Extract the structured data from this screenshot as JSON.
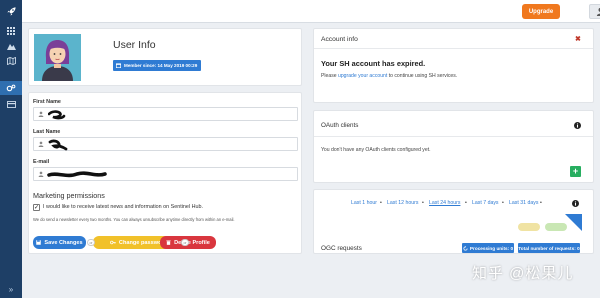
{
  "topbar": {
    "upgrade_label": "Upgrade",
    "accent": "#f0781e"
  },
  "sidebar": {
    "items": [
      {
        "icon": "grid-icon"
      },
      {
        "icon": "mountains-icon"
      },
      {
        "icon": "map-icon"
      },
      {
        "icon": "cogs-icon",
        "active": true
      },
      {
        "icon": "card-icon"
      }
    ],
    "expand_label": "»",
    "bg": "#1e3f66"
  },
  "user_info": {
    "title": "User Info",
    "member_since": "Member since: 14 May 2019 00:29"
  },
  "profile": {
    "first_name_label": "First Name",
    "last_name_label": "Last Name",
    "email_label": "E-mail",
    "marketing_title": "Marketing permissions",
    "marketing_checkbox_label": "I would like to receive latest news and information on Sentinel Hub.",
    "marketing_checked": true,
    "marketing_note": "We do send a newsletter every two months. You can always unsubscribe anytime directly from within an e-mail.",
    "save_label": "Save Changes",
    "change_password_label": "Change password",
    "delete_label": "Delete Profile",
    "or_label": "or"
  },
  "account": {
    "title": "Account info",
    "expired_heading": "Your SH account has expired.",
    "msg_before": "Please ",
    "msg_link": "upgrade your account",
    "msg_after": " to continue using SH services."
  },
  "oauth": {
    "title": "OAuth clients",
    "message": "You don't have any OAuth clients configured yet.",
    "add_label": "+"
  },
  "ogc": {
    "ranges": [
      "Last 1 hour",
      "Last 12 hours",
      "Last 24 hours",
      "Last 7 days",
      "Last 31 days"
    ],
    "selected_range": "Last 24 hours",
    "title": "OGC requests",
    "processing_units": "Processing units: 0",
    "total_requests": "Total number of requests: 0"
  },
  "watermark": "知乎 @松果儿"
}
